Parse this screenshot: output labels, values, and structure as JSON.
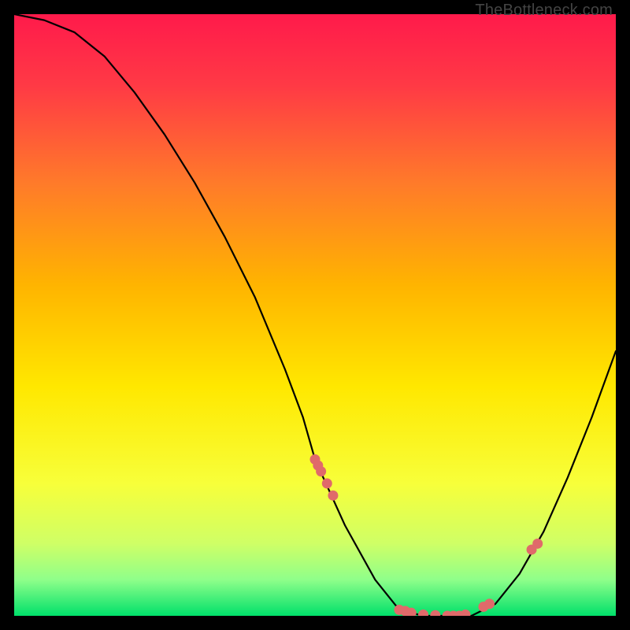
{
  "watermark": "TheBottleneck.com",
  "chart_data": {
    "type": "line",
    "title": "",
    "xlabel": "",
    "ylabel": "",
    "xlim": [
      0,
      100
    ],
    "ylim": [
      0,
      100
    ],
    "grid": false,
    "legend": false,
    "background_gradient": {
      "top": "#ff1a4b",
      "mid": "#ffe800",
      "bottom": "#00e06a"
    },
    "series": [
      {
        "name": "curve",
        "x": [
          0,
          5,
          10,
          15,
          20,
          25,
          30,
          35,
          40,
          45,
          48,
          50,
          55,
          60,
          64,
          68,
          72,
          76,
          80,
          84,
          88,
          92,
          96,
          100
        ],
        "y": [
          100,
          99,
          97,
          93,
          87,
          80,
          72,
          63,
          53,
          41,
          33,
          26,
          15,
          6,
          1,
          0,
          0,
          0,
          2,
          7,
          14,
          23,
          33,
          44
        ]
      }
    ],
    "markers": {
      "name": "points",
      "color": "#e06a6a",
      "x": [
        50,
        50.5,
        51,
        52,
        53,
        64,
        65,
        66,
        68,
        70,
        72,
        73,
        74,
        75,
        78,
        79,
        86,
        87
      ],
      "y": [
        26,
        25,
        24,
        22,
        20,
        1,
        0.8,
        0.5,
        0.2,
        0.1,
        0,
        0,
        0,
        0.2,
        1.5,
        2,
        11,
        12
      ]
    }
  }
}
